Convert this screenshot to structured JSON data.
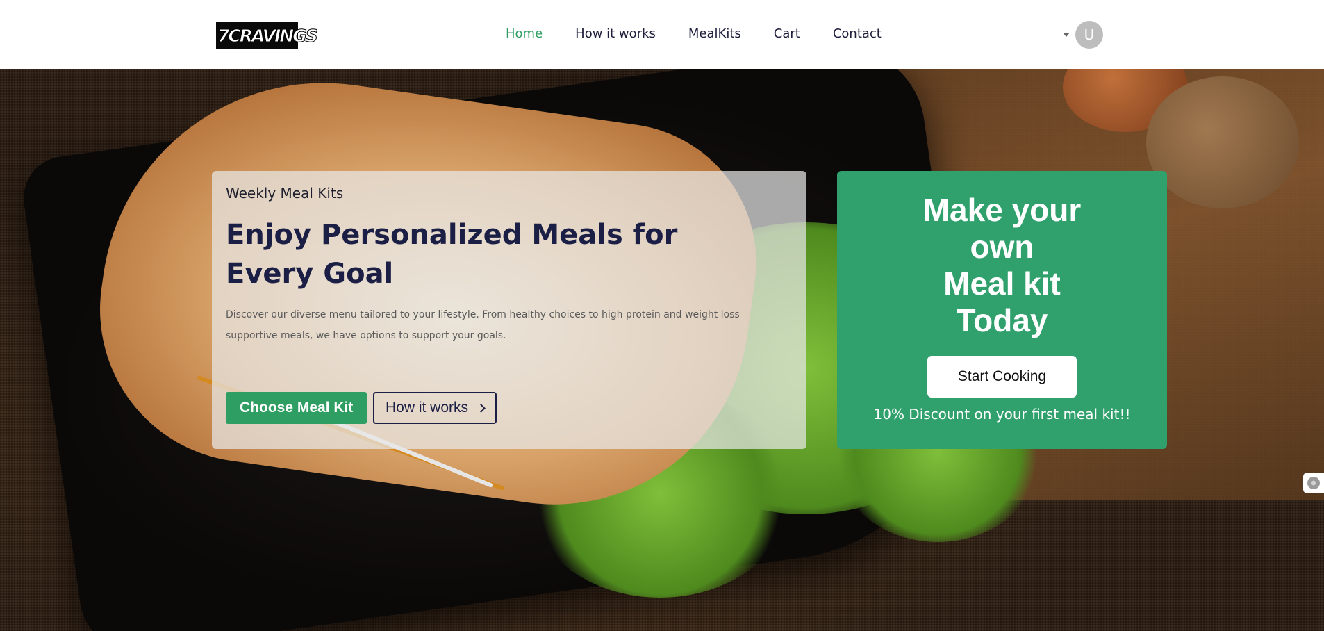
{
  "brand": {
    "logo_text": "7CRAVINGS"
  },
  "nav": {
    "items": [
      {
        "label": "Home",
        "active": true
      },
      {
        "label": "How it works",
        "active": false
      },
      {
        "label": "MealKits",
        "active": false
      },
      {
        "label": "Cart",
        "active": false
      },
      {
        "label": "Contact",
        "active": false
      }
    ],
    "active_color": "#2f9e63",
    "text_color": "#1d1d3b"
  },
  "user": {
    "avatar_initial": "U",
    "dropdown_icon": "caret-down-icon"
  },
  "hero": {
    "eyebrow": "Weekly Meal Kits",
    "headline": "Enjoy Personalized Meals for Every Goal",
    "description": "Discover our diverse menu tailored to your lifestyle. From healthy choices to high protein and weight loss supportive meals, we have options to support your goals.",
    "primary_button": "Choose Meal Kit",
    "secondary_button": "How it works",
    "secondary_icon": "chevron-right-icon"
  },
  "promo": {
    "title_lines": [
      "Make your",
      "own",
      "Meal kit",
      "Today"
    ],
    "button": "Start Cooking",
    "discount": "10% Discount on your first meal kit!!",
    "background_color": "#30a06d"
  },
  "side_widget": {
    "icon": "settings-icon"
  }
}
